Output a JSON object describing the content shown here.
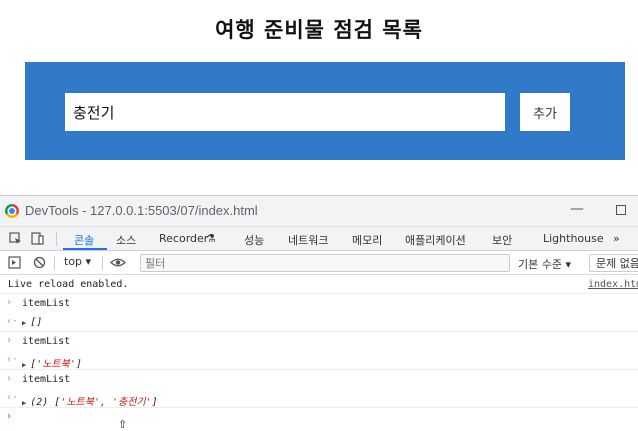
{
  "page": {
    "title": "여행 준비물 점검 목록",
    "input_value": "충전기",
    "add_button_label": "추가",
    "form_color": "#3179c9"
  },
  "devtools": {
    "window_title": "DevTools - 127.0.0.1:5503/07/index.html",
    "tabs": [
      "콘솔",
      "소스",
      "Recorder",
      "성능",
      "네트워크",
      "메모리",
      "애플리케이션",
      "보안",
      "Lighthouse"
    ],
    "active_tab": "콘솔",
    "more_tabs_label": "»",
    "toolbar": {
      "context": "top",
      "filter_placeholder": "필터",
      "level": "기본 수준",
      "issues": "문제 없음"
    },
    "console": {
      "live_reload": "Live reload enabled.",
      "live_reload_source": "index.html",
      "entries": [
        {
          "input": "itemList",
          "result": "[]"
        },
        {
          "input": "itemList",
          "result_prefix": "[",
          "items": "'노트북'",
          "result_suffix": "]"
        },
        {
          "input": "itemList",
          "result_prefix": "(2) [",
          "items": "'노트북', '충전기'",
          "result_suffix": "]"
        }
      ]
    }
  }
}
